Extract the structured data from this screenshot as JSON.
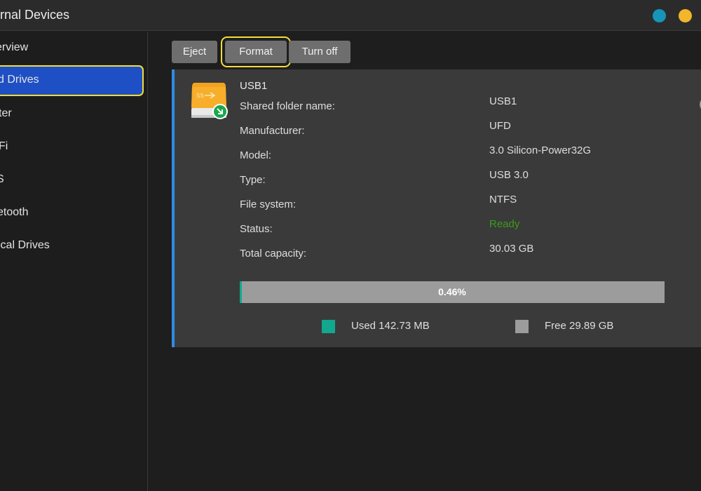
{
  "window": {
    "title": "ernal Devices"
  },
  "sidebar": {
    "items": [
      {
        "label": "erview"
      },
      {
        "label": "d Drives",
        "active": true
      },
      {
        "label": "ter"
      },
      {
        "label": "Fi"
      },
      {
        "label": "S"
      },
      {
        "label": "etooth"
      },
      {
        "label": "ical Drives"
      }
    ]
  },
  "toolbar": {
    "eject_label": "Eject",
    "format_label": "Format",
    "turnoff_label": "Turn off"
  },
  "drive": {
    "name": "USB1",
    "icon": "usb-drive-icon",
    "fields": [
      {
        "label": "Shared folder name:",
        "value": "USB1"
      },
      {
        "label": "Manufacturer:",
        "value": "UFD"
      },
      {
        "label": "Model:",
        "value": "3.0 Silicon-Power32G"
      },
      {
        "label": "Type:",
        "value": "USB 3.0"
      },
      {
        "label": "File system:",
        "value": "NTFS"
      },
      {
        "label": "Status:",
        "value": "Ready"
      },
      {
        "label": "Total capacity:",
        "value": "30.03 GB"
      }
    ],
    "usage": {
      "percent_label": "0.46%",
      "fraction": 0.0046,
      "used_label": "Used 142.73 MB",
      "free_label": "Free 29.89 GB"
    }
  },
  "colors": {
    "accent_blue": "#1f4fc4",
    "highlight_yellow": "#f3dc3a",
    "used_teal": "#12a88f",
    "free_gray": "#9c9c9c",
    "ready_green": "#3a9c1b",
    "card_border": "#2e8ce8"
  }
}
